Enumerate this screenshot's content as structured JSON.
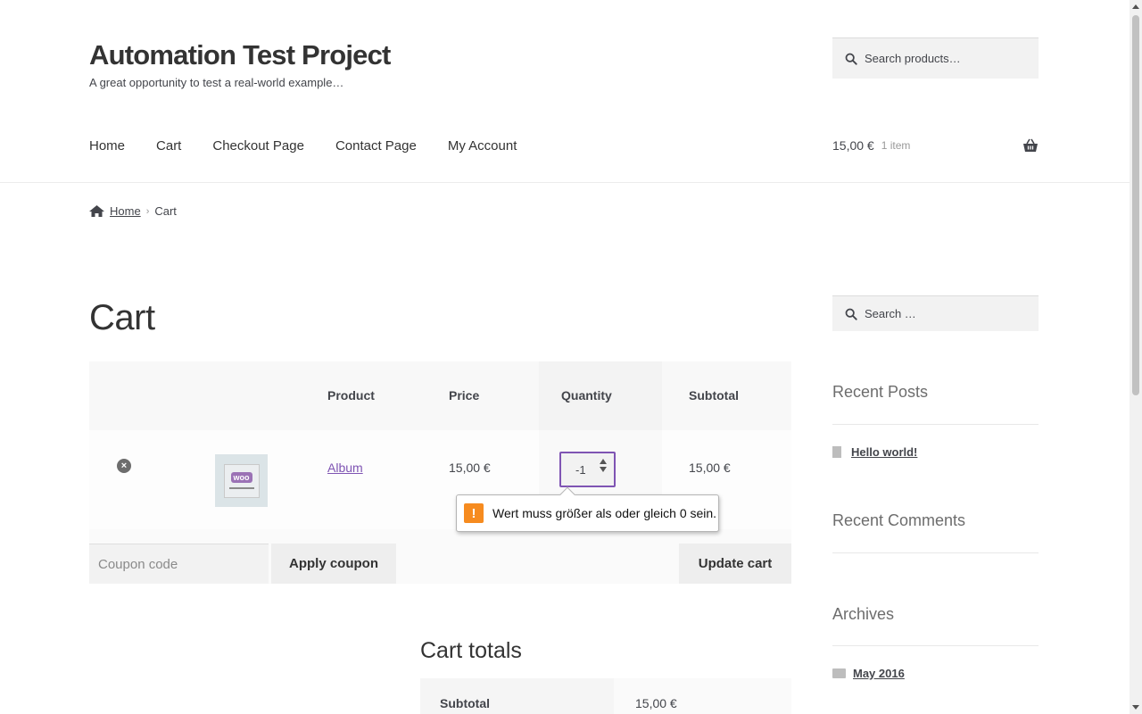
{
  "header": {
    "site_title": "Automation Test Project",
    "site_description": "A great opportunity to test a real-world example…",
    "search_placeholder": "Search products…",
    "nav": [
      "Home",
      "Cart",
      "Checkout Page",
      "Contact Page",
      "My Account"
    ],
    "mini_cart": {
      "amount": "15,00 €",
      "count": "1 item"
    }
  },
  "breadcrumb": {
    "home": "Home",
    "current": "Cart"
  },
  "page_title": "Cart",
  "cart": {
    "columns": {
      "product": "Product",
      "price": "Price",
      "quantity": "Quantity",
      "subtotal": "Subtotal"
    },
    "items": [
      {
        "remove": "×",
        "thumb_label": "woo",
        "name": "Album",
        "price": "15,00 €",
        "quantity": "-1",
        "subtotal": "15,00 €"
      }
    ],
    "coupon_placeholder": "Coupon code",
    "apply_coupon": "Apply coupon",
    "update_cart": "Update cart"
  },
  "validation": {
    "icon": "!",
    "message": "Wert muss größer als oder gleich 0 sein.",
    "icon_color": "#f68b1f"
  },
  "totals": {
    "title": "Cart totals",
    "subtotal_label": "Subtotal",
    "subtotal_value": "15,00 €"
  },
  "sidebar": {
    "search_placeholder": "Search …",
    "recent_posts": {
      "title": "Recent Posts",
      "items": [
        "Hello world!"
      ]
    },
    "recent_comments": {
      "title": "Recent Comments"
    },
    "archives": {
      "title": "Archives",
      "items": [
        "May 2016"
      ]
    }
  },
  "colors": {
    "accent": "#7f54b3",
    "text": "#43454b",
    "heading": "#333333"
  }
}
